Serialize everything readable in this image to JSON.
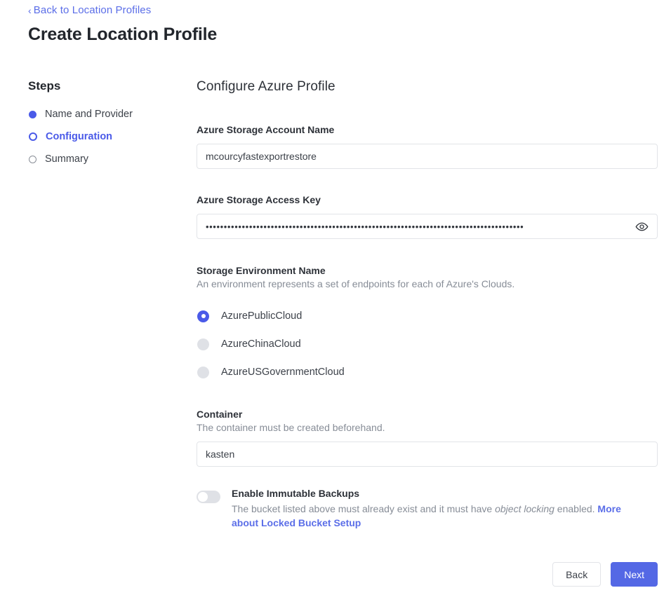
{
  "header": {
    "back_chevron": "chevron-left-icon",
    "back_link": "Back to Location Profiles",
    "title": "Create Location Profile"
  },
  "steps": {
    "title": "Steps",
    "items": [
      {
        "label": "Name and Provider",
        "state": "done"
      },
      {
        "label": "Configuration",
        "state": "current"
      },
      {
        "label": "Summary",
        "state": "todo"
      }
    ]
  },
  "form": {
    "heading": "Configure Azure Profile",
    "account": {
      "label": "Azure Storage Account Name",
      "value": "mcourcyfastexportrestore",
      "placeholder": ""
    },
    "access_key": {
      "label": "Azure Storage Access Key",
      "masked_value": "••••••••••••••••••••••••••••••••••••••••••••••••••••••••••••••••••••••••••••••••••••••••",
      "reveal_icon": "eye-icon"
    },
    "environment": {
      "label": "Storage Environment Name",
      "help": "An environment represents a set of endpoints for each of Azure's Clouds.",
      "options": [
        {
          "label": "AzurePublicCloud",
          "selected": true
        },
        {
          "label": "AzureChinaCloud",
          "selected": false
        },
        {
          "label": "AzureUSGovernmentCloud",
          "selected": false
        }
      ]
    },
    "container": {
      "label": "Container",
      "help": "The container must be created beforehand.",
      "value": "kasten"
    },
    "immutable": {
      "title": "Enable Immutable Backups",
      "enabled": false,
      "desc_part1": "The bucket listed above must already exist and it must have ",
      "desc_emphasis": "object locking",
      "desc_part2": " enabled. ",
      "link": "More about Locked Bucket Setup"
    }
  },
  "footer": {
    "back_label": "Back",
    "next_label": "Next"
  },
  "colors": {
    "accent": "#5468e5",
    "link": "#5b6ee8",
    "step_active": "#4a5ae8",
    "border": "#e2e4e8",
    "muted_text": "#878d97"
  }
}
